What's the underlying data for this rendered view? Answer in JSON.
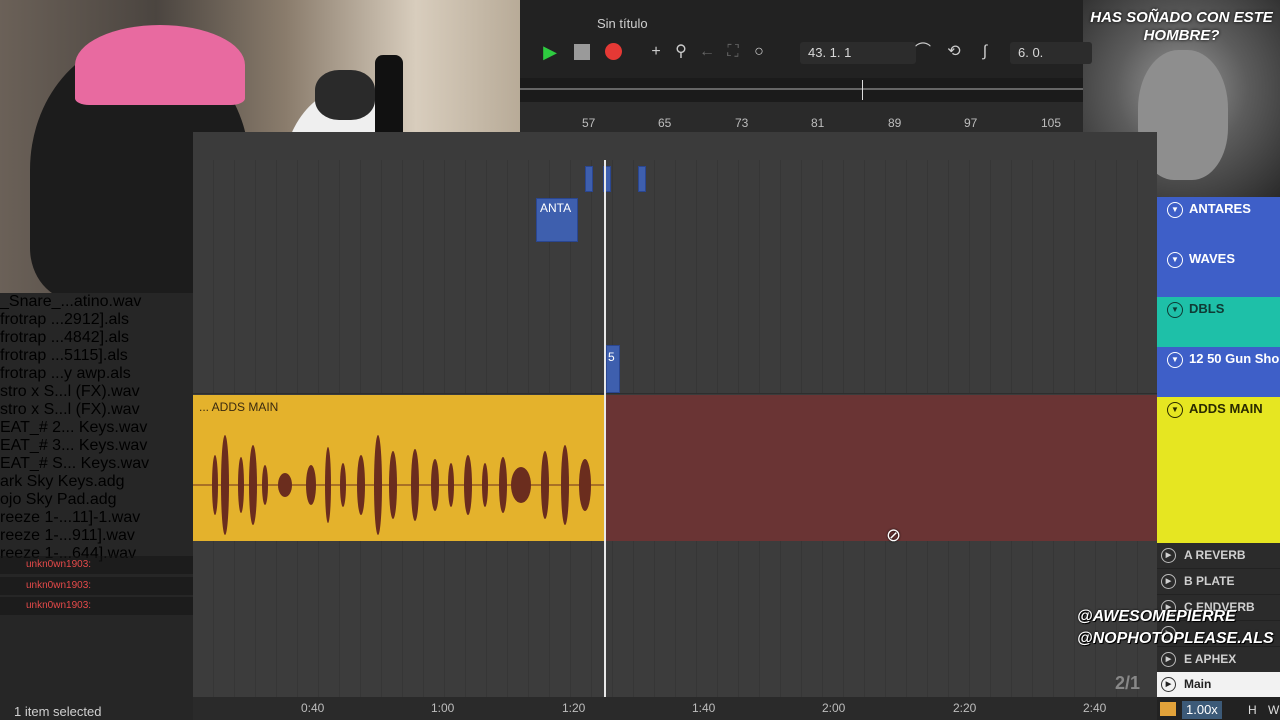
{
  "webcam_caption": "HAS SOÑADO CON ESTE HOMBRE?",
  "project": {
    "title": "Sin título"
  },
  "transport": {
    "position": "43.  1.  1",
    "loop_length": "6.  0."
  },
  "ruler_bars": [
    "57",
    "65",
    "73",
    "81",
    "89",
    "97",
    "105"
  ],
  "browser_items": [
    "_Snare_...atino.wav",
    "frotrap ...2912].als",
    "frotrap ...4842].als",
    "frotrap ...5115].als",
    "frotrap ...y awp.als",
    "stro x S...l (FX).wav",
    "stro x S...l (FX).wav",
    "EAT_# 2... Keys.wav",
    "EAT_# 3... Keys.wav",
    "EAT_# S... Keys.wav",
    "ark Sky Keys.adg",
    "ojo Sky Pad.adg",
    "reeze 1-...11]-1.wav",
    "reeze 1-...911].wav",
    "reeze 1-...644].wav"
  ],
  "status_text": "1 item selected",
  "chat": [
    "unkn0wn1903:",
    "unkn0wn1903:",
    "unkn0wn1903:"
  ],
  "clips": {
    "antares_label": "ANTA",
    "marker_label": "5",
    "adds_main_label": "... ADDS MAIN"
  },
  "tracks": [
    {
      "name": "ANTARES",
      "color": "#3e5fc8"
    },
    {
      "name": "WAVES",
      "color": "#3e5fc8"
    },
    {
      "name": "DBLS",
      "color": "#1ec0a8"
    },
    {
      "name": "12 50 Gun Sho",
      "color": "#3e5fc8"
    },
    {
      "name": "ADDS MAIN",
      "color": "#e6e621"
    }
  ],
  "returns": [
    "A REVERB",
    "B PLATE",
    "C ENDVERB",
    "E APHEX"
  ],
  "main_track": "Main",
  "time_labels": [
    "0:40",
    "1:00",
    "1:20",
    "1:40",
    "2:00",
    "2:20",
    "2:40"
  ],
  "social": {
    "handle1": "@AWESOMEPIERRE",
    "handle2": "@NOPHOTOPLEASE.ALS"
  },
  "page_counter": "2/1",
  "footer": {
    "zoom": "1.00x",
    "h_label": "H",
    "w_label": "W"
  }
}
